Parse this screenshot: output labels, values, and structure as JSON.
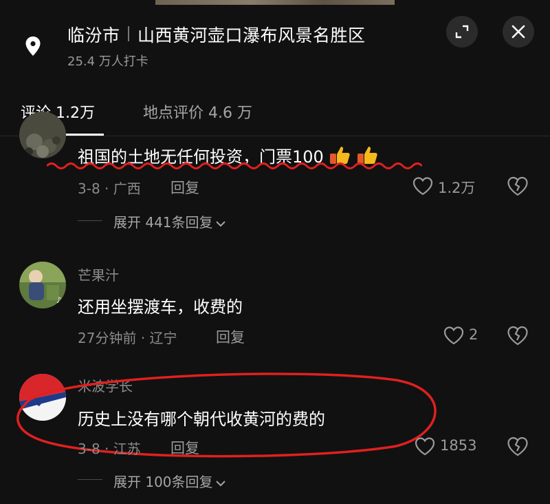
{
  "header": {
    "city": "临汾市",
    "place_name": "山西黄河壶口瀑布风景名胜区",
    "checkins": "25.4 万人打卡"
  },
  "tabs": [
    {
      "label": "评论 1.2万"
    },
    {
      "label": "地点评价 4.6 万"
    }
  ],
  "comments": [
    {
      "username": "",
      "text": "祖国的土地无任何投资，门票100",
      "emoji": "thumbs-up-icon x2",
      "meta": "3-8 · 广西",
      "reply_label": "回复",
      "likes": "1.2万",
      "expand_label": "展开 441条回复"
    },
    {
      "username": "芒果汁",
      "text": "还用坐摆渡车，收费的",
      "meta": "27分钟前 · 辽宁",
      "reply_label": "回复",
      "likes": "2"
    },
    {
      "username": "米波学长",
      "text": "历史上没有哪个朝代收黄河的费的",
      "meta": "3-8 · 江苏",
      "reply_label": "回复",
      "likes": "1853",
      "expand_label": "展开 100条回复"
    }
  ],
  "icons": {
    "location": "location-pin-icon",
    "expand": "expand-corners-icon",
    "close": "close-icon",
    "like": "heart-outline-icon",
    "dislike": "broken-heart-icon",
    "chevron": "chevron-down-icon"
  },
  "colors": {
    "background": "#111111",
    "annotation_red": "#e02020",
    "secondary_text": "#8b8b8b"
  }
}
